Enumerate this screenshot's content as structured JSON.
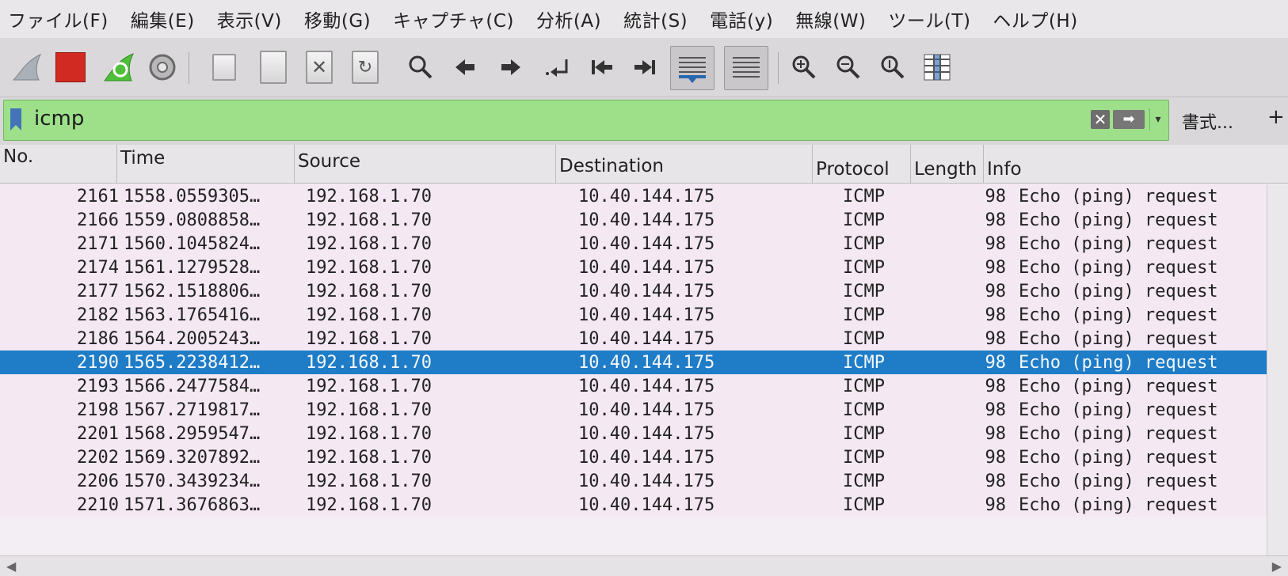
{
  "menu": [
    "ファイル(F)",
    "編集(E)",
    "表示(V)",
    "移動(G)",
    "キャプチャ(C)",
    "分析(A)",
    "統計(S)",
    "電話(y)",
    "無線(W)",
    "ツール(T)",
    "ヘルプ(H)"
  ],
  "toolbar": {
    "icons": [
      "shark-fin-icon",
      "stop-icon",
      "restart-icon",
      "gear-icon",
      "open-file-icon",
      "save-file-icon",
      "close-file-icon",
      "reload-file-icon",
      "find-icon",
      "back-arrow-icon",
      "forward-arrow-icon",
      "go-to-packet-icon",
      "first-packet-icon",
      "last-packet-icon",
      "autoscroll-icon",
      "colorize-icon",
      "zoom-in-icon",
      "zoom-out-icon",
      "normal-size-icon",
      "resize-columns-icon"
    ]
  },
  "filter": {
    "value": "icmp",
    "expression_label": "書式...",
    "plus_label": "+"
  },
  "columns": [
    "No.",
    "Time",
    "Source",
    "Destination",
    "Protocol",
    "Length",
    "Info"
  ],
  "rows": [
    {
      "no": "2161",
      "time": "1558.0559305…",
      "source": "192.168.1.70",
      "destination": "10.40.144.175",
      "protocol": "ICMP",
      "length": "98",
      "info": "Echo (ping) request"
    },
    {
      "no": "2166",
      "time": "1559.0808858…",
      "source": "192.168.1.70",
      "destination": "10.40.144.175",
      "protocol": "ICMP",
      "length": "98",
      "info": "Echo (ping) request"
    },
    {
      "no": "2171",
      "time": "1560.1045824…",
      "source": "192.168.1.70",
      "destination": "10.40.144.175",
      "protocol": "ICMP",
      "length": "98",
      "info": "Echo (ping) request"
    },
    {
      "no": "2174",
      "time": "1561.1279528…",
      "source": "192.168.1.70",
      "destination": "10.40.144.175",
      "protocol": "ICMP",
      "length": "98",
      "info": "Echo (ping) request"
    },
    {
      "no": "2177",
      "time": "1562.1518806…",
      "source": "192.168.1.70",
      "destination": "10.40.144.175",
      "protocol": "ICMP",
      "length": "98",
      "info": "Echo (ping) request"
    },
    {
      "no": "2182",
      "time": "1563.1765416…",
      "source": "192.168.1.70",
      "destination": "10.40.144.175",
      "protocol": "ICMP",
      "length": "98",
      "info": "Echo (ping) request"
    },
    {
      "no": "2186",
      "time": "1564.2005243…",
      "source": "192.168.1.70",
      "destination": "10.40.144.175",
      "protocol": "ICMP",
      "length": "98",
      "info": "Echo (ping) request"
    },
    {
      "no": "2190",
      "time": "1565.2238412…",
      "source": "192.168.1.70",
      "destination": "10.40.144.175",
      "protocol": "ICMP",
      "length": "98",
      "info": "Echo (ping) request",
      "selected": true
    },
    {
      "no": "2193",
      "time": "1566.2477584…",
      "source": "192.168.1.70",
      "destination": "10.40.144.175",
      "protocol": "ICMP",
      "length": "98",
      "info": "Echo (ping) request"
    },
    {
      "no": "2198",
      "time": "1567.2719817…",
      "source": "192.168.1.70",
      "destination": "10.40.144.175",
      "protocol": "ICMP",
      "length": "98",
      "info": "Echo (ping) request"
    },
    {
      "no": "2201",
      "time": "1568.2959547…",
      "source": "192.168.1.70",
      "destination": "10.40.144.175",
      "protocol": "ICMP",
      "length": "98",
      "info": "Echo (ping) request"
    },
    {
      "no": "2202",
      "time": "1569.3207892…",
      "source": "192.168.1.70",
      "destination": "10.40.144.175",
      "protocol": "ICMP",
      "length": "98",
      "info": "Echo (ping) request"
    },
    {
      "no": "2206",
      "time": "1570.3439234…",
      "source": "192.168.1.70",
      "destination": "10.40.144.175",
      "protocol": "ICMP",
      "length": "98",
      "info": "Echo (ping) request"
    },
    {
      "no": "2210",
      "time": "1571.3676863…",
      "source": "192.168.1.70",
      "destination": "10.40.144.175",
      "protocol": "ICMP",
      "length": "98",
      "info": "Echo (ping) request"
    }
  ],
  "colors": {
    "filter_valid": "#9ee08a",
    "row_bg": "#f4e8f3",
    "selected_row": "#1f7cc7"
  }
}
